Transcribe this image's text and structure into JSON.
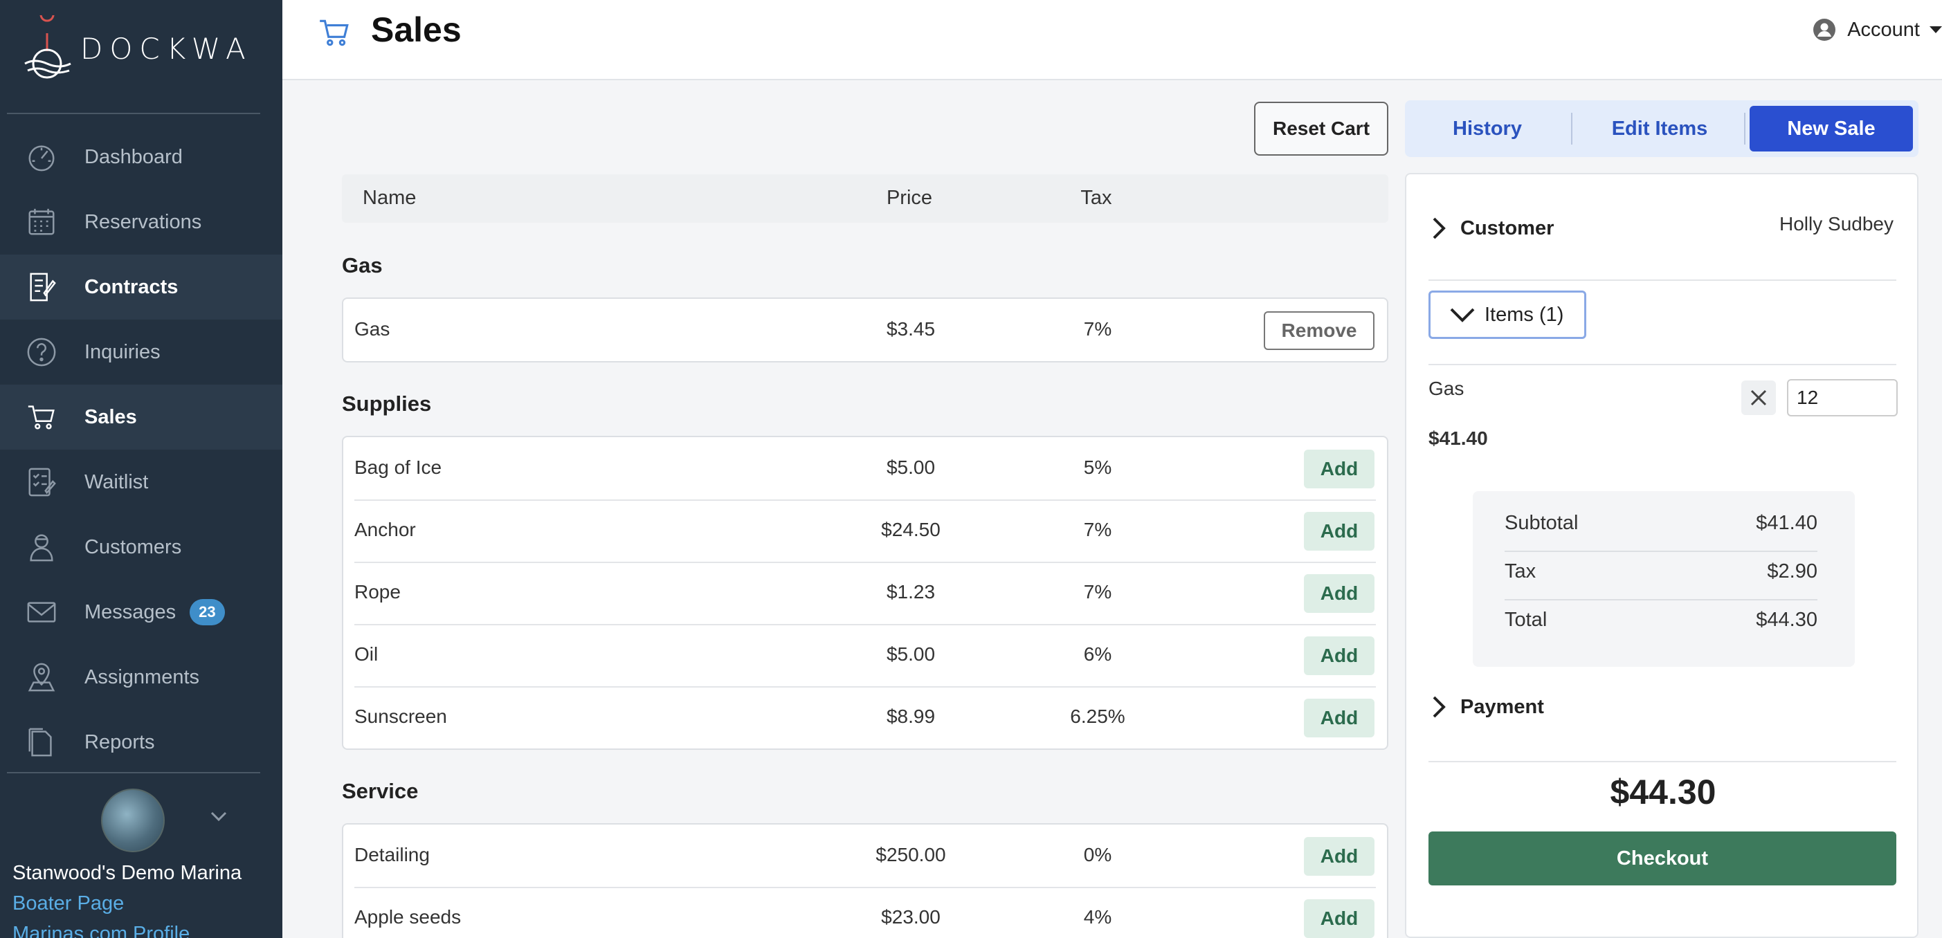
{
  "brand": {
    "name": "DOCKWA"
  },
  "sidebar": {
    "items": [
      {
        "label": "Dashboard",
        "icon": "gauge-icon"
      },
      {
        "label": "Reservations",
        "icon": "calendar-icon"
      },
      {
        "label": "Contracts",
        "icon": "contract-icon"
      },
      {
        "label": "Inquiries",
        "icon": "question-icon"
      },
      {
        "label": "Sales",
        "icon": "cart-icon"
      },
      {
        "label": "Waitlist",
        "icon": "checklist-icon"
      },
      {
        "label": "Customers",
        "icon": "person-icon"
      },
      {
        "label": "Messages",
        "icon": "envelope-icon",
        "badge": "23"
      },
      {
        "label": "Assignments",
        "icon": "map-pin-icon"
      },
      {
        "label": "Reports",
        "icon": "document-icon"
      }
    ],
    "marina_name": "Stanwood's Demo Marina",
    "boater_link": "Boater Page",
    "marinas_link": "Marinas.com Profile"
  },
  "header": {
    "title": "Sales",
    "account": "Account"
  },
  "toolbar": {
    "reset_label": "Reset Cart"
  },
  "table": {
    "columns": [
      "Name",
      "Price",
      "Tax"
    ],
    "groups": [
      {
        "title": "Gas",
        "items": [
          {
            "name": "Gas",
            "price": "$3.45",
            "tax": "7%",
            "action": "Remove"
          }
        ]
      },
      {
        "title": "Supplies",
        "items": [
          {
            "name": "Bag of Ice",
            "price": "$5.00",
            "tax": "5%",
            "action": "Add"
          },
          {
            "name": "Anchor",
            "price": "$24.50",
            "tax": "7%",
            "action": "Add"
          },
          {
            "name": "Rope",
            "price": "$1.23",
            "tax": "7%",
            "action": "Add"
          },
          {
            "name": "Oil",
            "price": "$5.00",
            "tax": "6%",
            "action": "Add"
          },
          {
            "name": "Sunscreen",
            "price": "$8.99",
            "tax": "6.25%",
            "action": "Add"
          }
        ]
      },
      {
        "title": "Service",
        "items": [
          {
            "name": "Detailing",
            "price": "$250.00",
            "tax": "0%",
            "action": "Add"
          },
          {
            "name": "Apple seeds",
            "price": "$23.00",
            "tax": "4%",
            "action": "Add"
          }
        ]
      }
    ]
  },
  "tabs": [
    {
      "label": "History",
      "active": false
    },
    {
      "label": "Edit Items",
      "active": false
    },
    {
      "label": "New Sale",
      "active": true
    }
  ],
  "cart": {
    "customer_label": "Customer",
    "customer_name": "Holly Sudbey",
    "items_label": "Items (1)",
    "line": {
      "name": "Gas",
      "qty": "12",
      "total": "$41.40"
    },
    "summary": [
      {
        "label": "Subtotal",
        "value": "$41.40"
      },
      {
        "label": "Tax",
        "value": "$2.90"
      },
      {
        "label": "Total",
        "value": "$44.30"
      }
    ],
    "payment_label": "Payment",
    "grand_total": "$44.30",
    "checkout_label": "Checkout"
  },
  "colors": {
    "sidebar": "#233140",
    "accent": "#2a4fd0",
    "checkout": "#3d7a5c",
    "add": "#deeee6"
  }
}
